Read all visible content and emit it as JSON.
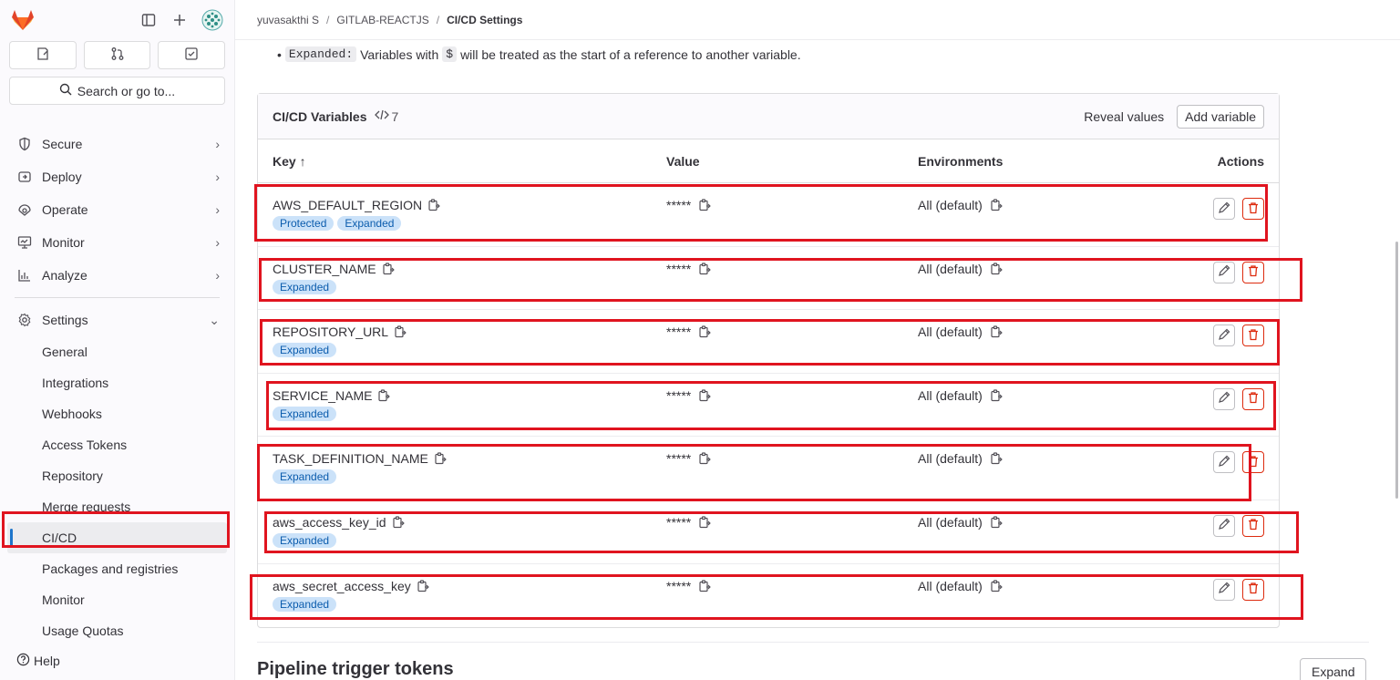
{
  "breadcrumb": [
    "yuvasakthi S",
    "GITLAB-REACTJS",
    "CI/CD Settings"
  ],
  "sidebar": {
    "search_label": "Search or go to...",
    "nav": [
      {
        "label": "Secure",
        "icon": "shield-icon"
      },
      {
        "label": "Deploy",
        "icon": "deploy-icon"
      },
      {
        "label": "Operate",
        "icon": "operate-icon"
      },
      {
        "label": "Monitor",
        "icon": "monitor-icon"
      },
      {
        "label": "Analyze",
        "icon": "chart-icon"
      }
    ],
    "settings_label": "Settings",
    "settings_items": [
      "General",
      "Integrations",
      "Webhooks",
      "Access Tokens",
      "Repository",
      "Merge requests",
      "CI/CD",
      "Packages and registries",
      "Monitor",
      "Usage Quotas"
    ],
    "active_item": "CI/CD",
    "help_label": "Help"
  },
  "intro": {
    "code": "Expanded:",
    "text_a": "Variables with",
    "dollar": "$",
    "text_b": "will be treated as the start of a reference to another variable."
  },
  "variables": {
    "title": "CI/CD Variables",
    "count": "7",
    "reveal_label": "Reveal values",
    "add_label": "Add variable",
    "headers": {
      "key": "Key ↑",
      "value": "Value",
      "environments": "Environments",
      "actions": "Actions"
    },
    "rows": [
      {
        "key": "AWS_DEFAULT_REGION",
        "badges": [
          "Protected",
          "Expanded"
        ],
        "value": "*****",
        "env": "All (default)"
      },
      {
        "key": "CLUSTER_NAME",
        "badges": [
          "Expanded"
        ],
        "value": "*****",
        "env": "All (default)"
      },
      {
        "key": "REPOSITORY_URL",
        "badges": [
          "Expanded"
        ],
        "value": "*****",
        "env": "All (default)"
      },
      {
        "key": "SERVICE_NAME",
        "badges": [
          "Expanded"
        ],
        "value": "*****",
        "env": "All (default)"
      },
      {
        "key": "TASK_DEFINITION_NAME",
        "badges": [
          "Expanded"
        ],
        "value": "*****",
        "env": "All (default)"
      },
      {
        "key": "aws_access_key_id",
        "badges": [
          "Expanded"
        ],
        "value": "*****",
        "env": "All (default)"
      },
      {
        "key": "aws_secret_access_key",
        "badges": [
          "Expanded"
        ],
        "value": "*****",
        "env": "All (default)"
      }
    ]
  },
  "pipeline": {
    "title": "Pipeline trigger tokens",
    "expand_label": "Expand"
  },
  "colors": {
    "highlight": "#e0141f",
    "badge_bg": "#cbe2f9",
    "active_bar": "#1f75cb",
    "delete": "#dd2b0e"
  }
}
